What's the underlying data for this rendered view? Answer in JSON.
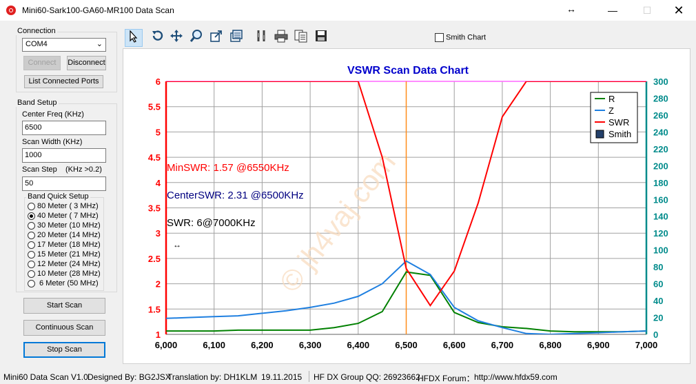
{
  "window": {
    "title": "Mini60-Sark100-GA60-MR100 Data Scan"
  },
  "connection": {
    "group_title": "Connection",
    "port_value": "COM4",
    "connect_label": "Connect",
    "disconnect_label": "Disconnect",
    "list_ports_label": "List Connected Ports"
  },
  "band_setup": {
    "group_title": "Band Setup",
    "center_freq_label": "Center Freq  (KHz)",
    "center_freq_value": "6500",
    "scan_width_label": "Scan Width   (KHz)",
    "scan_width_value": "1000",
    "scan_step_label": "Scan Step",
    "scan_step_hint": "(KHz >0.2)",
    "scan_step_value": "50",
    "quick_setup_title": "Band Quick Setup",
    "bands": [
      {
        "label": "80 Meter  (  3 MHz)",
        "selected": false
      },
      {
        "label": "40 Meter  (  7 MHz)",
        "selected": true
      },
      {
        "label": "30 Meter  (10 MHz)",
        "selected": false
      },
      {
        "label": "20 Meter  (14 MHz)",
        "selected": false
      },
      {
        "label": "17 Meter  (18 MHz)",
        "selected": false
      },
      {
        "label": "15 Meter  (21 MHz)",
        "selected": false
      },
      {
        "label": "12 Meter  (24 MHz)",
        "selected": false
      },
      {
        "label": "10 Meter  (28 MHz)",
        "selected": false
      },
      {
        "label": " 6 Meter   (50 MHz)",
        "selected": false
      }
    ]
  },
  "actions": {
    "start_scan": "Start Scan",
    "continuous_scan": "Continuous Scan",
    "stop_scan": "Stop Scan"
  },
  "toolbar": {
    "smith_chart_label": "Smith Chart",
    "smith_chart_checked": false,
    "icons": [
      "pointer-icon",
      "undo-icon",
      "pan-icon",
      "zoom-icon",
      "zoom-box-icon",
      "data-icon",
      "settings-icon",
      "print-icon",
      "copy-icon",
      "save-icon"
    ]
  },
  "annotations": {
    "min_swr": "MinSWR: 1.57 @6550KHz",
    "center_swr": "CenterSWR: 2.31 @6500KHz",
    "cursor_swr": "SWR: 6@7000KHz",
    "watermark": "© jh4vaj.com"
  },
  "chart_data": {
    "type": "line",
    "title": "VSWR Scan Data Chart",
    "x": [
      6000,
      6050,
      6100,
      6150,
      6200,
      6250,
      6300,
      6350,
      6400,
      6450,
      6500,
      6550,
      6600,
      6650,
      6700,
      6750,
      6800,
      6850,
      6900,
      6950,
      7000
    ],
    "xlim": [
      6000,
      7000
    ],
    "xticks": [
      "6,000",
      "6,100",
      "6,200",
      "6,300",
      "6,400",
      "6,500",
      "6,600",
      "6,700",
      "6,800",
      "6,900",
      "7,000"
    ],
    "ylim_left": [
      1,
      6
    ],
    "yticks_left": [
      "1",
      "1.5",
      "2",
      "2.5",
      "3",
      "3.5",
      "4",
      "4.5",
      "5",
      "5.5",
      "6"
    ],
    "ylim_right": [
      0,
      300
    ],
    "yticks_right": [
      "0",
      "20",
      "40",
      "60",
      "80",
      "100",
      "120",
      "140",
      "160",
      "180",
      "200",
      "220",
      "240",
      "260",
      "280",
      "300"
    ],
    "center_marker_x": 6500,
    "grid": true,
    "legend_position": "top-right",
    "series": [
      {
        "name": "R",
        "axis": "right",
        "color": "#008000",
        "values": [
          4,
          4,
          4,
          5,
          5,
          5,
          5,
          8,
          13,
          27,
          74,
          70,
          26,
          14,
          9,
          7,
          4,
          3,
          3,
          3,
          4
        ]
      },
      {
        "name": "Z",
        "axis": "right",
        "color": "#1e7fe0",
        "values": [
          19,
          20,
          21,
          22,
          25,
          28,
          32,
          37,
          45,
          60,
          87,
          71,
          32,
          16,
          8,
          1,
          0,
          1,
          2,
          3,
          4
        ]
      },
      {
        "name": "SWR",
        "axis": "left",
        "color": "#ff0000",
        "values": [
          6,
          6,
          6,
          6,
          6,
          6,
          6,
          6,
          6,
          4.5,
          2.3,
          1.57,
          2.25,
          3.6,
          5.3,
          6,
          6,
          6,
          6,
          6,
          6
        ]
      },
      {
        "name": "Smith",
        "axis": "none",
        "color": "#24406a",
        "values": []
      }
    ]
  },
  "status": {
    "app": "Mini60 Data Scan V1.0",
    "designer": "Designed By: BG2JSX",
    "translation": "Translation by: DH1KLM",
    "date": "19.11.2015",
    "group": "HF DX Group QQ: 26923662",
    "forum": "HFDX Forum：",
    "url": "http://www.hfdx59.com"
  },
  "colors": {
    "title_blue": "#0000cc",
    "left_axis": "#ff0000",
    "right_axis": "#008b8b",
    "top_border": "#ff66ff",
    "marker_orange": "#ff8c1a"
  }
}
